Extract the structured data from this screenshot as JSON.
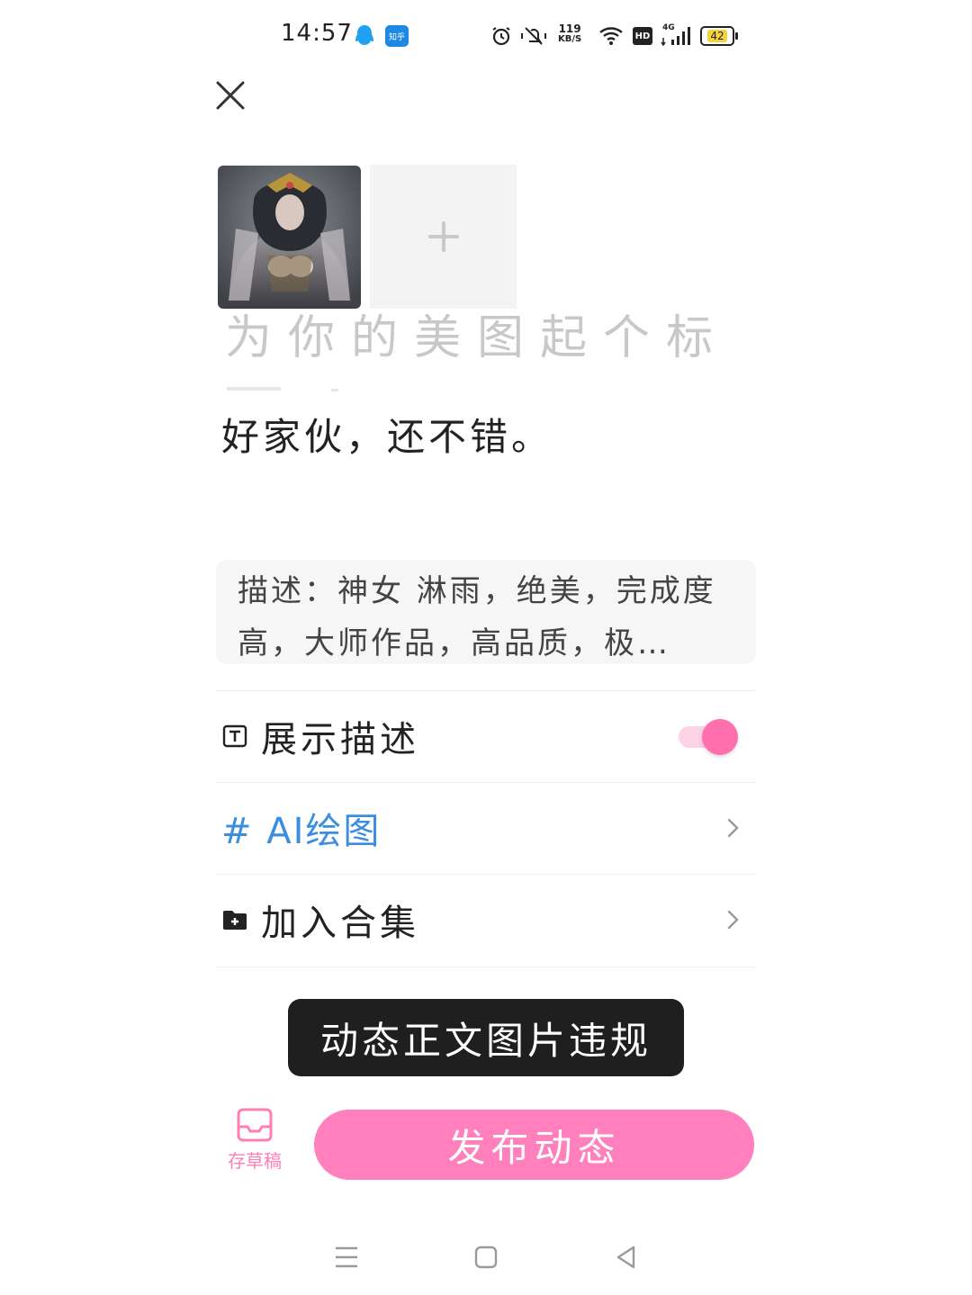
{
  "status_bar": {
    "time": "14:57",
    "net_speed_value": "119",
    "net_speed_unit": "KB/S",
    "battery": "42",
    "icons": [
      "qq-icon",
      "zhihu-icon",
      "alarm-icon",
      "vibrate-off-icon",
      "wifi-icon",
      "hd-icon",
      "signal-4g-icon",
      "battery-icon"
    ],
    "zhihu_label": "知乎",
    "hd_label": "HD",
    "network_label": "4G"
  },
  "editor": {
    "ghost_text": "为你的美图起个标",
    "caption": "好家伙，还不错。",
    "description": "描述：神女 淋雨，绝美，完成度高，大师作品，高品质，极…"
  },
  "options": {
    "show_description_label": "展示描述",
    "show_description_enabled": true,
    "topic_label": "# AI绘图",
    "collection_label": "加入合集"
  },
  "toast": "动态正文图片违规",
  "bottom": {
    "draft_label": "存草稿",
    "publish_label": "发布动态"
  },
  "colors": {
    "accent_pink": "#ff80bd",
    "topic_blue": "#3b8de0",
    "toast_bg": "#1f1f1f"
  }
}
